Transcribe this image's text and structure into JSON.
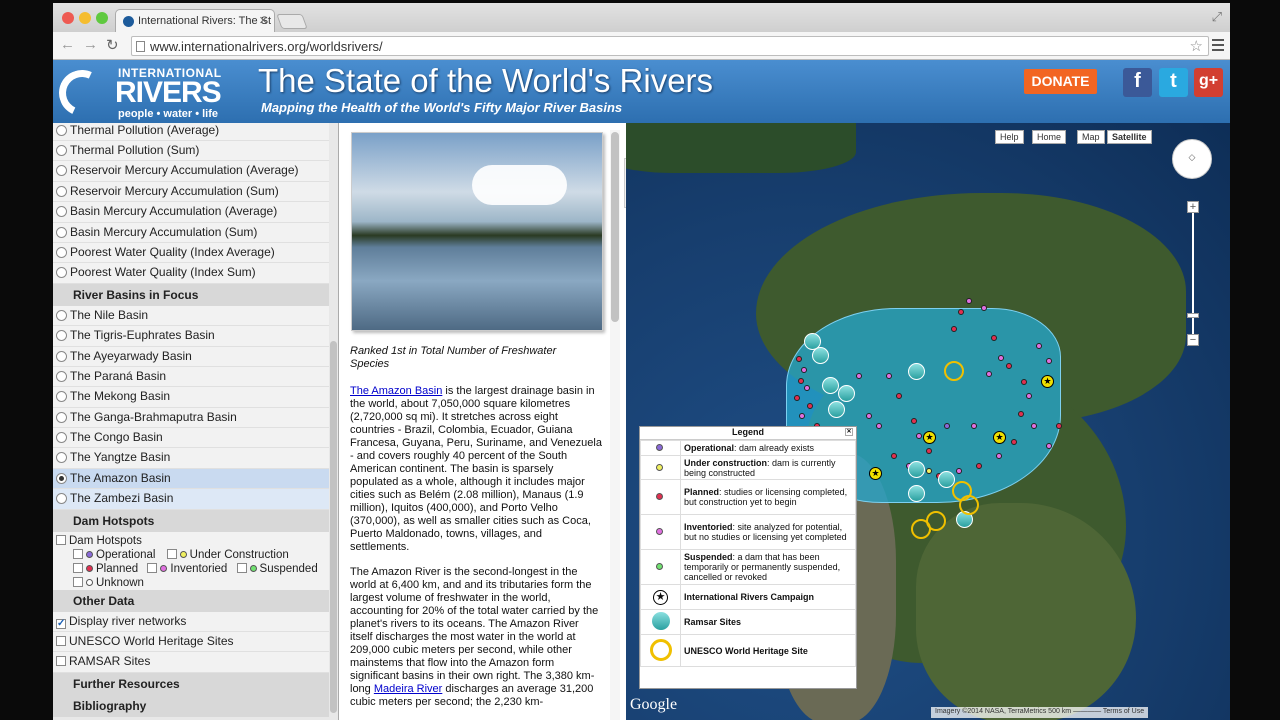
{
  "browser": {
    "tab_title": "International Rivers: The St",
    "url": "www.internationalrivers.org/worldsrivers/"
  },
  "header": {
    "logo_top": "INTERNATIONAL",
    "logo_main": "RIVERS",
    "logo_tag": "people • water • life",
    "title": "The State of the World's Rivers",
    "subtitle": "Mapping the Health of the World's Fifty Major River Basins",
    "donate": "DONATE",
    "fb": "f",
    "tw": "t",
    "gp": "g+"
  },
  "sidebar": {
    "indicators": [
      "Thermal Pollution (Average)",
      "Thermal Pollution (Sum)",
      "Reservoir Mercury Accumulation (Average)",
      "Reservoir Mercury Accumulation (Sum)",
      "Basin Mercury Accumulation (Average)",
      "Basin Mercury Accumulation (Sum)",
      "Poorest Water Quality (Index Average)",
      "Poorest Water Quality (Index Sum)"
    ],
    "basins_heading": "River Basins in Focus",
    "basins": [
      "The Nile Basin",
      "The Tigris-Euphrates Basin",
      "The Ayeyarwady Basin",
      "The Paraná Basin",
      "The Mekong Basin",
      "The Ganga-Brahmaputra Basin",
      "The Congo Basin",
      "The Yangtze Basin",
      "The Amazon Basin",
      "The Zambezi Basin"
    ],
    "selected_basin": "The Amazon Basin",
    "dam_heading": "Dam Hotspots",
    "dam_label": "Dam Hotspots",
    "dam_ops": {
      "operational": "Operational",
      "under_construction": "Under Construction",
      "planned": "Planned",
      "inventoried": "Inventoried",
      "suspended": "Suspended",
      "unknown": "Unknown"
    },
    "other_heading": "Other Data",
    "other": {
      "river_networks": "Display river networks",
      "unesco": "UNESCO World Heritage Sites",
      "ramsar": "RAMSAR Sites"
    },
    "further": "Further Resources",
    "biblio": "Bibliography"
  },
  "article": {
    "caption": "Ranked 1st in Total Number of Freshwater Species",
    "p1_link": "The Amazon Basin",
    "p1": " is the largest drainage basin in the world, about 7,050,000 square kilometres (2,720,000 sq mi). It stretches across eight countries - Brazil, Colombia, Ecuador, Guiana Francesa, Guyana, Peru, Suriname, and Venezuela - and covers roughly 40 percent of the South American continent. The basin is sparsely populated as a whole, although it includes major cities such as Belém (2.08 million), Manaus (1.9 million), Iquitos (400,000), and Porto Velho (370,000), as well as smaller cities such as Coca, Puerto Maldonado, towns, villages, and settlements.",
    "p2a": "The Amazon River is the second-longest in the world at 6,400 km, and and its tributaries form the largest volume of freshwater in the world, accounting for 20% of the total water carried by the planet's rivers to its oceans. The Amazon River itself discharges the most water in the world at 209,000 cubic meters per second, while other mainstems that flow into the Amazon form significant basins in their own right. The 3,380 km-long ",
    "p2_link": "Madeira River",
    "p2b": " discharges an average 31,200 cubic meters per second; the 2,230 km-"
  },
  "map": {
    "help": "Help",
    "home": "Home",
    "map": "Map",
    "satellite": "Satellite",
    "legend_title": "Legend",
    "legend": [
      {
        "b": "Operational",
        "t": ": dam already exists",
        "color": "#8a6ad8",
        "kind": "dot"
      },
      {
        "b": "Under construction",
        "t": ": dam is currently being constructed",
        "color": "#f0f060",
        "kind": "dot"
      },
      {
        "b": "Planned",
        "t": ": studies or licensing completed, but construction yet to begin",
        "color": "#e03050",
        "kind": "dot"
      },
      {
        "b": "Inventoried",
        "t": ": site analyzed for potential, but no studies or licensing yet completed",
        "color": "#e070e0",
        "kind": "dot"
      },
      {
        "b": "Suspended",
        "t": ": a dam that has been temporarily or permanently suspended, cancelled or revoked",
        "color": "#70e070",
        "kind": "dot"
      },
      {
        "b": "International Rivers Campaign",
        "t": "",
        "color": "#000000",
        "kind": "star"
      },
      {
        "b": "Ramsar Sites",
        "t": "",
        "color": "#2aa0a0",
        "kind": "ramsar"
      },
      {
        "b": "UNESCO World Heritage Site",
        "t": "",
        "color": "#f0c000",
        "kind": "unesco"
      }
    ],
    "google": "Google",
    "attribution": "Imagery ©2014 NASA, TerraMetrics   500 km ————   Terms of Use"
  }
}
